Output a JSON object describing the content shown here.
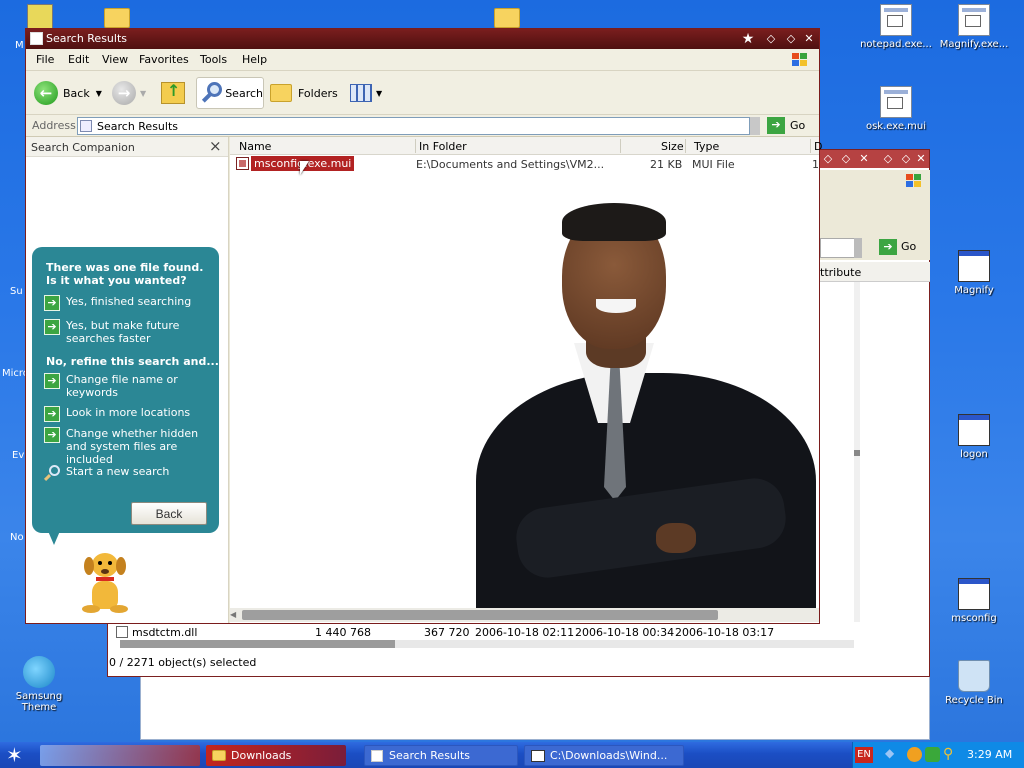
{
  "desktop": {
    "icons_right": [
      {
        "label": "notepad.exe...",
        "icon": "exe-file-icon"
      },
      {
        "label": "Magnify.exe...",
        "icon": "exe-file-icon"
      },
      {
        "label": "osk.exe.mui",
        "icon": "exe-file-icon"
      },
      {
        "label": "Magnify",
        "icon": "window-icon"
      },
      {
        "label": "logon",
        "icon": "window-icon"
      },
      {
        "label": "msconfig",
        "icon": "window-icon"
      },
      {
        "label": "Recycle Bin",
        "icon": "recycle-bin-icon"
      }
    ],
    "icons_left": [
      {
        "label": "M",
        "icon": "app-icon"
      },
      {
        "label": "Su",
        "icon": "app-icon"
      },
      {
        "label": "Micro",
        "icon": "app-icon"
      },
      {
        "label": "Ev",
        "icon": "app-icon"
      },
      {
        "label": "No",
        "icon": "app-icon"
      },
      {
        "label": "Samsung Theme",
        "icon": "samsung-theme-icon"
      }
    ]
  },
  "back_window": {
    "go_label": "Go",
    "column_fragment": "ttribute",
    "row": {
      "name": "msdtctm.dll",
      "size": "1 440 768",
      "packed": "367 720",
      "date1": "2006-10-18 02:11",
      "date2": "2006-10-18 00:34",
      "date3": "2006-10-18 03:17"
    },
    "status": "0 / 2271 object(s) selected"
  },
  "window": {
    "title": "Search Results",
    "menu": [
      "File",
      "Edit",
      "View",
      "Favorites",
      "Tools",
      "Help"
    ],
    "toolbar": {
      "back": "Back",
      "search": "Search",
      "folders": "Folders"
    },
    "address": {
      "label": "Address",
      "value": "Search Results",
      "go": "Go"
    },
    "companion": {
      "title": "Search Companion",
      "close": "×",
      "question": "There was one file found.  Is it what you wanted?",
      "options": [
        "Yes, finished searching",
        "Yes, but make future searches faster"
      ],
      "refine_heading": "No, refine this search and...",
      "refine_options": [
        "Change file name or keywords",
        "Look in more locations",
        "Change whether hidden and system files are included"
      ],
      "new_search": "Start a new search",
      "back_button": "Back"
    },
    "columns": [
      "Name",
      "In Folder",
      "Size",
      "Type",
      "D"
    ],
    "results": [
      {
        "name": "msconfig.exe.mui",
        "folder": "E:\\Documents and Settings\\VM2...",
        "size": "21 KB",
        "type": "MUI File",
        "extra": "1"
      }
    ]
  },
  "taskbar": {
    "tasks": [
      "Downloads",
      "Search Results",
      "C:\\Downloads\\Wind..."
    ],
    "language": "EN",
    "clock": "3:29 AM"
  }
}
